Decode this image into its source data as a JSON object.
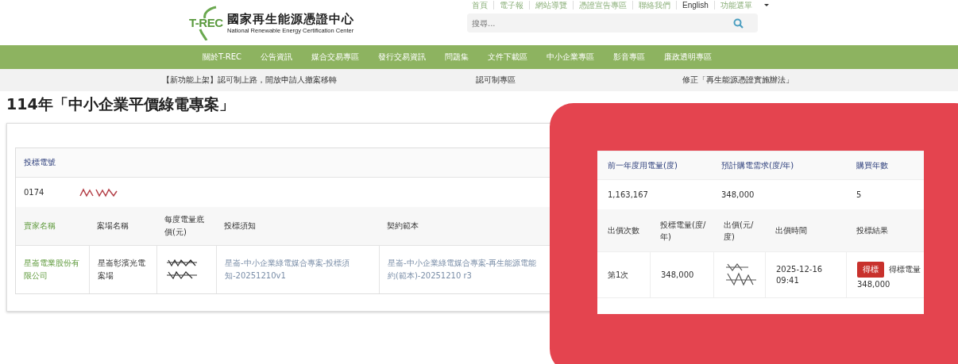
{
  "header": {
    "logo_mark": "T-REC",
    "org_name": "國家再生能源憑證中心",
    "org_name_en": "National Renewable Energy Certification Center",
    "top_links": [
      "首頁",
      "電子報",
      "網站導覽",
      "憑證宣告專區",
      "聯絡我們",
      "English"
    ],
    "menu_label": "功能選單",
    "search": {
      "placeholder": "搜尋..."
    }
  },
  "nav": [
    "關於T-REC",
    "公告資訊",
    "媒合交易專區",
    "發行交易資訊",
    "問題集",
    "文件下載區",
    "中小企業專區",
    "影音專區",
    "廉政透明專區"
  ],
  "notices": [
    "【新功能上架】認可制上路，開放申請人撤案移轉",
    "認可制專區",
    "修正「再生能源憑證實施辦法」"
  ],
  "page_title": "114年「中小企業平價綠電專案」",
  "bid_table": {
    "id_header": "投標電號",
    "id_value": "0174",
    "columns": [
      "賣家名稱",
      "案場名稱",
      "每度電量底價(元)",
      "投標須知",
      "契約範本"
    ],
    "row": {
      "seller": "星崙電業股份有限公司",
      "site": "星崙彰濱光電案場",
      "notice_link": "星崙-中小企業綠電媒合專案-投標須知-20251210v1",
      "contract_lines": [
        "星崙-中小企業綠電媒合專案-再生能源電能",
        "約(範本)-20251210 r3"
      ]
    }
  },
  "zoom_panel": {
    "columns": [
      "前一年度用電量(度)",
      "預計購電需求(度/年)",
      "購買年數"
    ],
    "values": [
      "1,163,167",
      "348,000",
      "5"
    ],
    "bid_columns": [
      "出價次數",
      "投標電量(度/年)",
      "出價(元/度)",
      "出價時間",
      "投標結果"
    ],
    "bid_row": {
      "round": "第1次",
      "volume": "348,000",
      "date": "2025-12-16",
      "time": "09:41",
      "result_badge": "得標",
      "result_label": "得標電量",
      "result_volume": "348,000"
    }
  }
}
